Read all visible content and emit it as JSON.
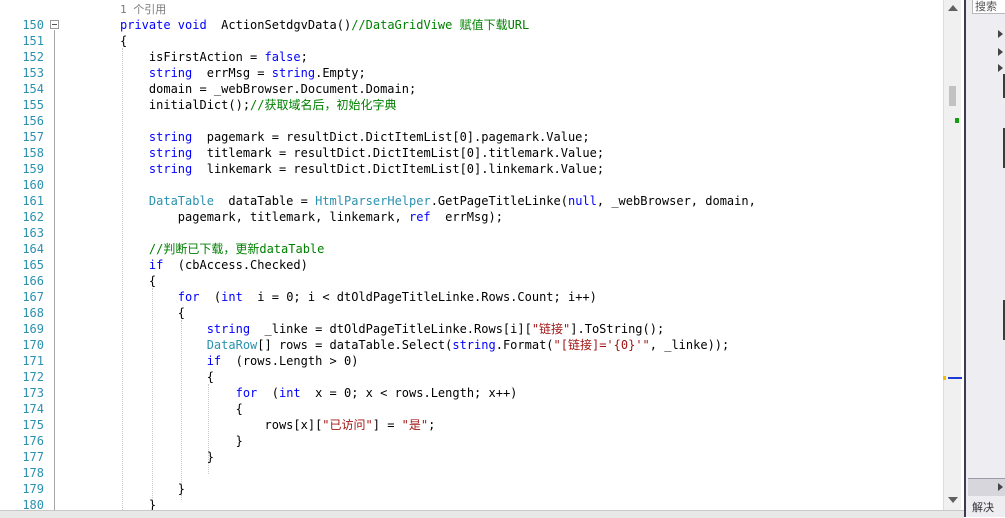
{
  "editor": {
    "codelens": "1 个引用",
    "lines": [
      {
        "n": "150",
        "segs": [
          [
            "kw",
            "private "
          ],
          [
            "kw",
            "void"
          ],
          [
            "",
            "  ActionSetdgvData()"
          ],
          [
            "cm",
            "//DataGridViwe 赋值下载URL"
          ]
        ]
      },
      {
        "n": "151",
        "segs": [
          [
            "",
            "{"
          ]
        ]
      },
      {
        "n": "152",
        "segs": [
          [
            "",
            "    isFirstAction = "
          ],
          [
            "kw",
            "false"
          ],
          [
            "",
            ";"
          ]
        ]
      },
      {
        "n": "153",
        "segs": [
          [
            "",
            "    "
          ],
          [
            "kw",
            "string"
          ],
          [
            "",
            "  errMsg = "
          ],
          [
            "kw",
            "string"
          ],
          [
            "",
            ".Empty;"
          ]
        ]
      },
      {
        "n": "154",
        "segs": [
          [
            "",
            "    domain = _webBrowser.Document.Domain;"
          ]
        ]
      },
      {
        "n": "155",
        "segs": [
          [
            "",
            "    initialDict();"
          ],
          [
            "cm",
            "//获取域名后，初始化字典"
          ]
        ]
      },
      {
        "n": "156",
        "segs": []
      },
      {
        "n": "157",
        "segs": [
          [
            "",
            "    "
          ],
          [
            "kw",
            "string"
          ],
          [
            "",
            "  pagemark = resultDict.DictItemList[0].pagemark.Value;"
          ]
        ]
      },
      {
        "n": "158",
        "segs": [
          [
            "",
            "    "
          ],
          [
            "kw",
            "string"
          ],
          [
            "",
            "  titlemark = resultDict.DictItemList[0].titlemark.Value;"
          ]
        ]
      },
      {
        "n": "159",
        "segs": [
          [
            "",
            "    "
          ],
          [
            "kw",
            "string"
          ],
          [
            "",
            "  linkemark = resultDict.DictItemList[0].linkemark.Value;"
          ]
        ]
      },
      {
        "n": "160",
        "segs": []
      },
      {
        "n": "161",
        "segs": [
          [
            "",
            "    "
          ],
          [
            "ty",
            "DataTable"
          ],
          [
            "",
            "  dataTable = "
          ],
          [
            "ty",
            "HtmlParserHelper"
          ],
          [
            "",
            ".GetPageTitleLinke("
          ],
          [
            "kw",
            "null"
          ],
          [
            "",
            ", _webBrowser, domain,"
          ]
        ]
      },
      {
        "n": "162",
        "segs": [
          [
            "",
            "        pagemark, titlemark, linkemark, "
          ],
          [
            "kw",
            "ref"
          ],
          [
            "",
            "  errMsg);"
          ]
        ]
      },
      {
        "n": "163",
        "segs": []
      },
      {
        "n": "164",
        "segs": [
          [
            "",
            "    "
          ],
          [
            "cm",
            "//判断已下载，更新dataTable"
          ]
        ]
      },
      {
        "n": "165",
        "segs": [
          [
            "",
            "    "
          ],
          [
            "kw",
            "if"
          ],
          [
            "",
            "  (cbAccess.Checked)"
          ]
        ]
      },
      {
        "n": "166",
        "segs": [
          [
            "",
            "    {"
          ]
        ]
      },
      {
        "n": "167",
        "segs": [
          [
            "",
            "        "
          ],
          [
            "kw",
            "for"
          ],
          [
            "",
            "  ("
          ],
          [
            "kw",
            "int"
          ],
          [
            "",
            "  i = 0; i < dtOldPageTitleLinke.Rows.Count; i++)"
          ]
        ]
      },
      {
        "n": "168",
        "segs": [
          [
            "",
            "        {"
          ]
        ]
      },
      {
        "n": "169",
        "segs": [
          [
            "",
            "            "
          ],
          [
            "kw",
            "string"
          ],
          [
            "",
            "  _linke = dtOldPageTitleLinke.Rows[i]["
          ],
          [
            "st",
            "\"链接\""
          ],
          [
            "",
            "].ToString();"
          ]
        ]
      },
      {
        "n": "170",
        "segs": [
          [
            "",
            "            "
          ],
          [
            "ty",
            "DataRow"
          ],
          [
            "",
            "[] rows = dataTable.Select("
          ],
          [
            "kw",
            "string"
          ],
          [
            "",
            ".Format("
          ],
          [
            "st",
            "\"[链接]='{0}'\""
          ],
          [
            "",
            ", _linke));"
          ]
        ]
      },
      {
        "n": "171",
        "segs": [
          [
            "",
            "            "
          ],
          [
            "kw",
            "if"
          ],
          [
            "",
            "  (rows.Length > 0)"
          ]
        ]
      },
      {
        "n": "172",
        "segs": [
          [
            "",
            "            {"
          ]
        ]
      },
      {
        "n": "173",
        "segs": [
          [
            "",
            "                "
          ],
          [
            "kw",
            "for"
          ],
          [
            "",
            "  ("
          ],
          [
            "kw",
            "int"
          ],
          [
            "",
            "  x = 0; x < rows.Length; x++)"
          ]
        ]
      },
      {
        "n": "174",
        "segs": [
          [
            "",
            "                {"
          ]
        ]
      },
      {
        "n": "175",
        "segs": [
          [
            "",
            "                    rows[x]["
          ],
          [
            "st",
            "\"已访问\""
          ],
          [
            "",
            "] = "
          ],
          [
            "st",
            "\"是\""
          ],
          [
            "",
            ";"
          ]
        ]
      },
      {
        "n": "176",
        "segs": [
          [
            "",
            "                }"
          ]
        ]
      },
      {
        "n": "177",
        "segs": [
          [
            "",
            "            }"
          ]
        ]
      },
      {
        "n": "178",
        "segs": []
      },
      {
        "n": "179",
        "segs": [
          [
            "",
            "        }"
          ]
        ]
      },
      {
        "n": "180",
        "segs": [
          [
            "",
            "    }"
          ]
        ]
      }
    ]
  },
  "right_panel": {
    "search_placeholder": "搜索",
    "bottom_label": "解决"
  },
  "colors": {
    "keyword": "#0000ff",
    "type": "#2b91af",
    "comment": "#008000",
    "string": "#a31515",
    "line_number": "#2b91af"
  }
}
